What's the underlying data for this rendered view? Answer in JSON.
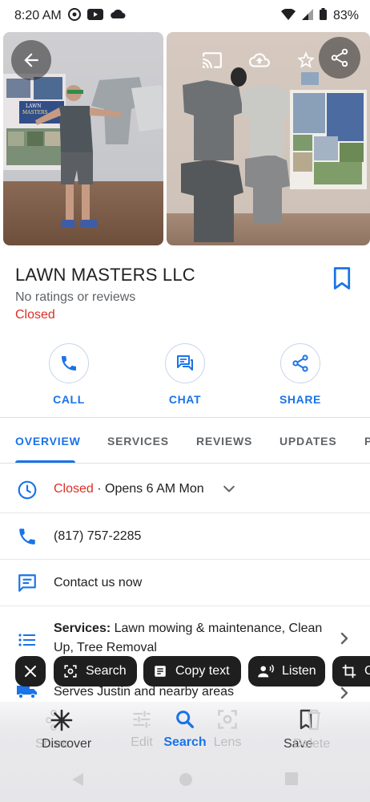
{
  "status_bar": {
    "time": "8:20 AM",
    "battery": "83%"
  },
  "business": {
    "name": "LAWN MASTERS LLC",
    "rating_text": "No ratings or reviews",
    "status": "Closed"
  },
  "photo_1_sign": {
    "line1": "LAWN",
    "line2": "MASTERS"
  },
  "actions": [
    {
      "label": "CALL",
      "icon": "phone-icon"
    },
    {
      "label": "CHAT",
      "icon": "chat-icon"
    },
    {
      "label": "SHARE",
      "icon": "share-icon"
    }
  ],
  "tabs": [
    "OVERVIEW",
    "SERVICES",
    "REVIEWS",
    "UPDATES",
    "P"
  ],
  "hours": {
    "status": "Closed",
    "separator": " · ",
    "next": "Opens 6 AM Mon"
  },
  "phone": "(817) 757-2285",
  "contact": "Contact us now",
  "services": {
    "label": "Services:",
    "text": " Lawn mowing & maintenance, Clean Up, Tree Removal"
  },
  "service_area": "Serves Justin and nearby areas",
  "selection_toolbar": {
    "search": "Search",
    "copy_text": "Copy text",
    "listen": "Listen",
    "crop_partial": "C"
  },
  "bottom_bar": {
    "share_overlap": "Share",
    "discover_overlap": "Discover",
    "edit": "Edit",
    "search": "Search",
    "lens": "Lens",
    "save_overlap": "Save",
    "delete_overlap": "Delete"
  },
  "colors": {
    "accent": "#1a73e8",
    "closed": "#d93025",
    "chip_bg": "#1f1f1f"
  }
}
